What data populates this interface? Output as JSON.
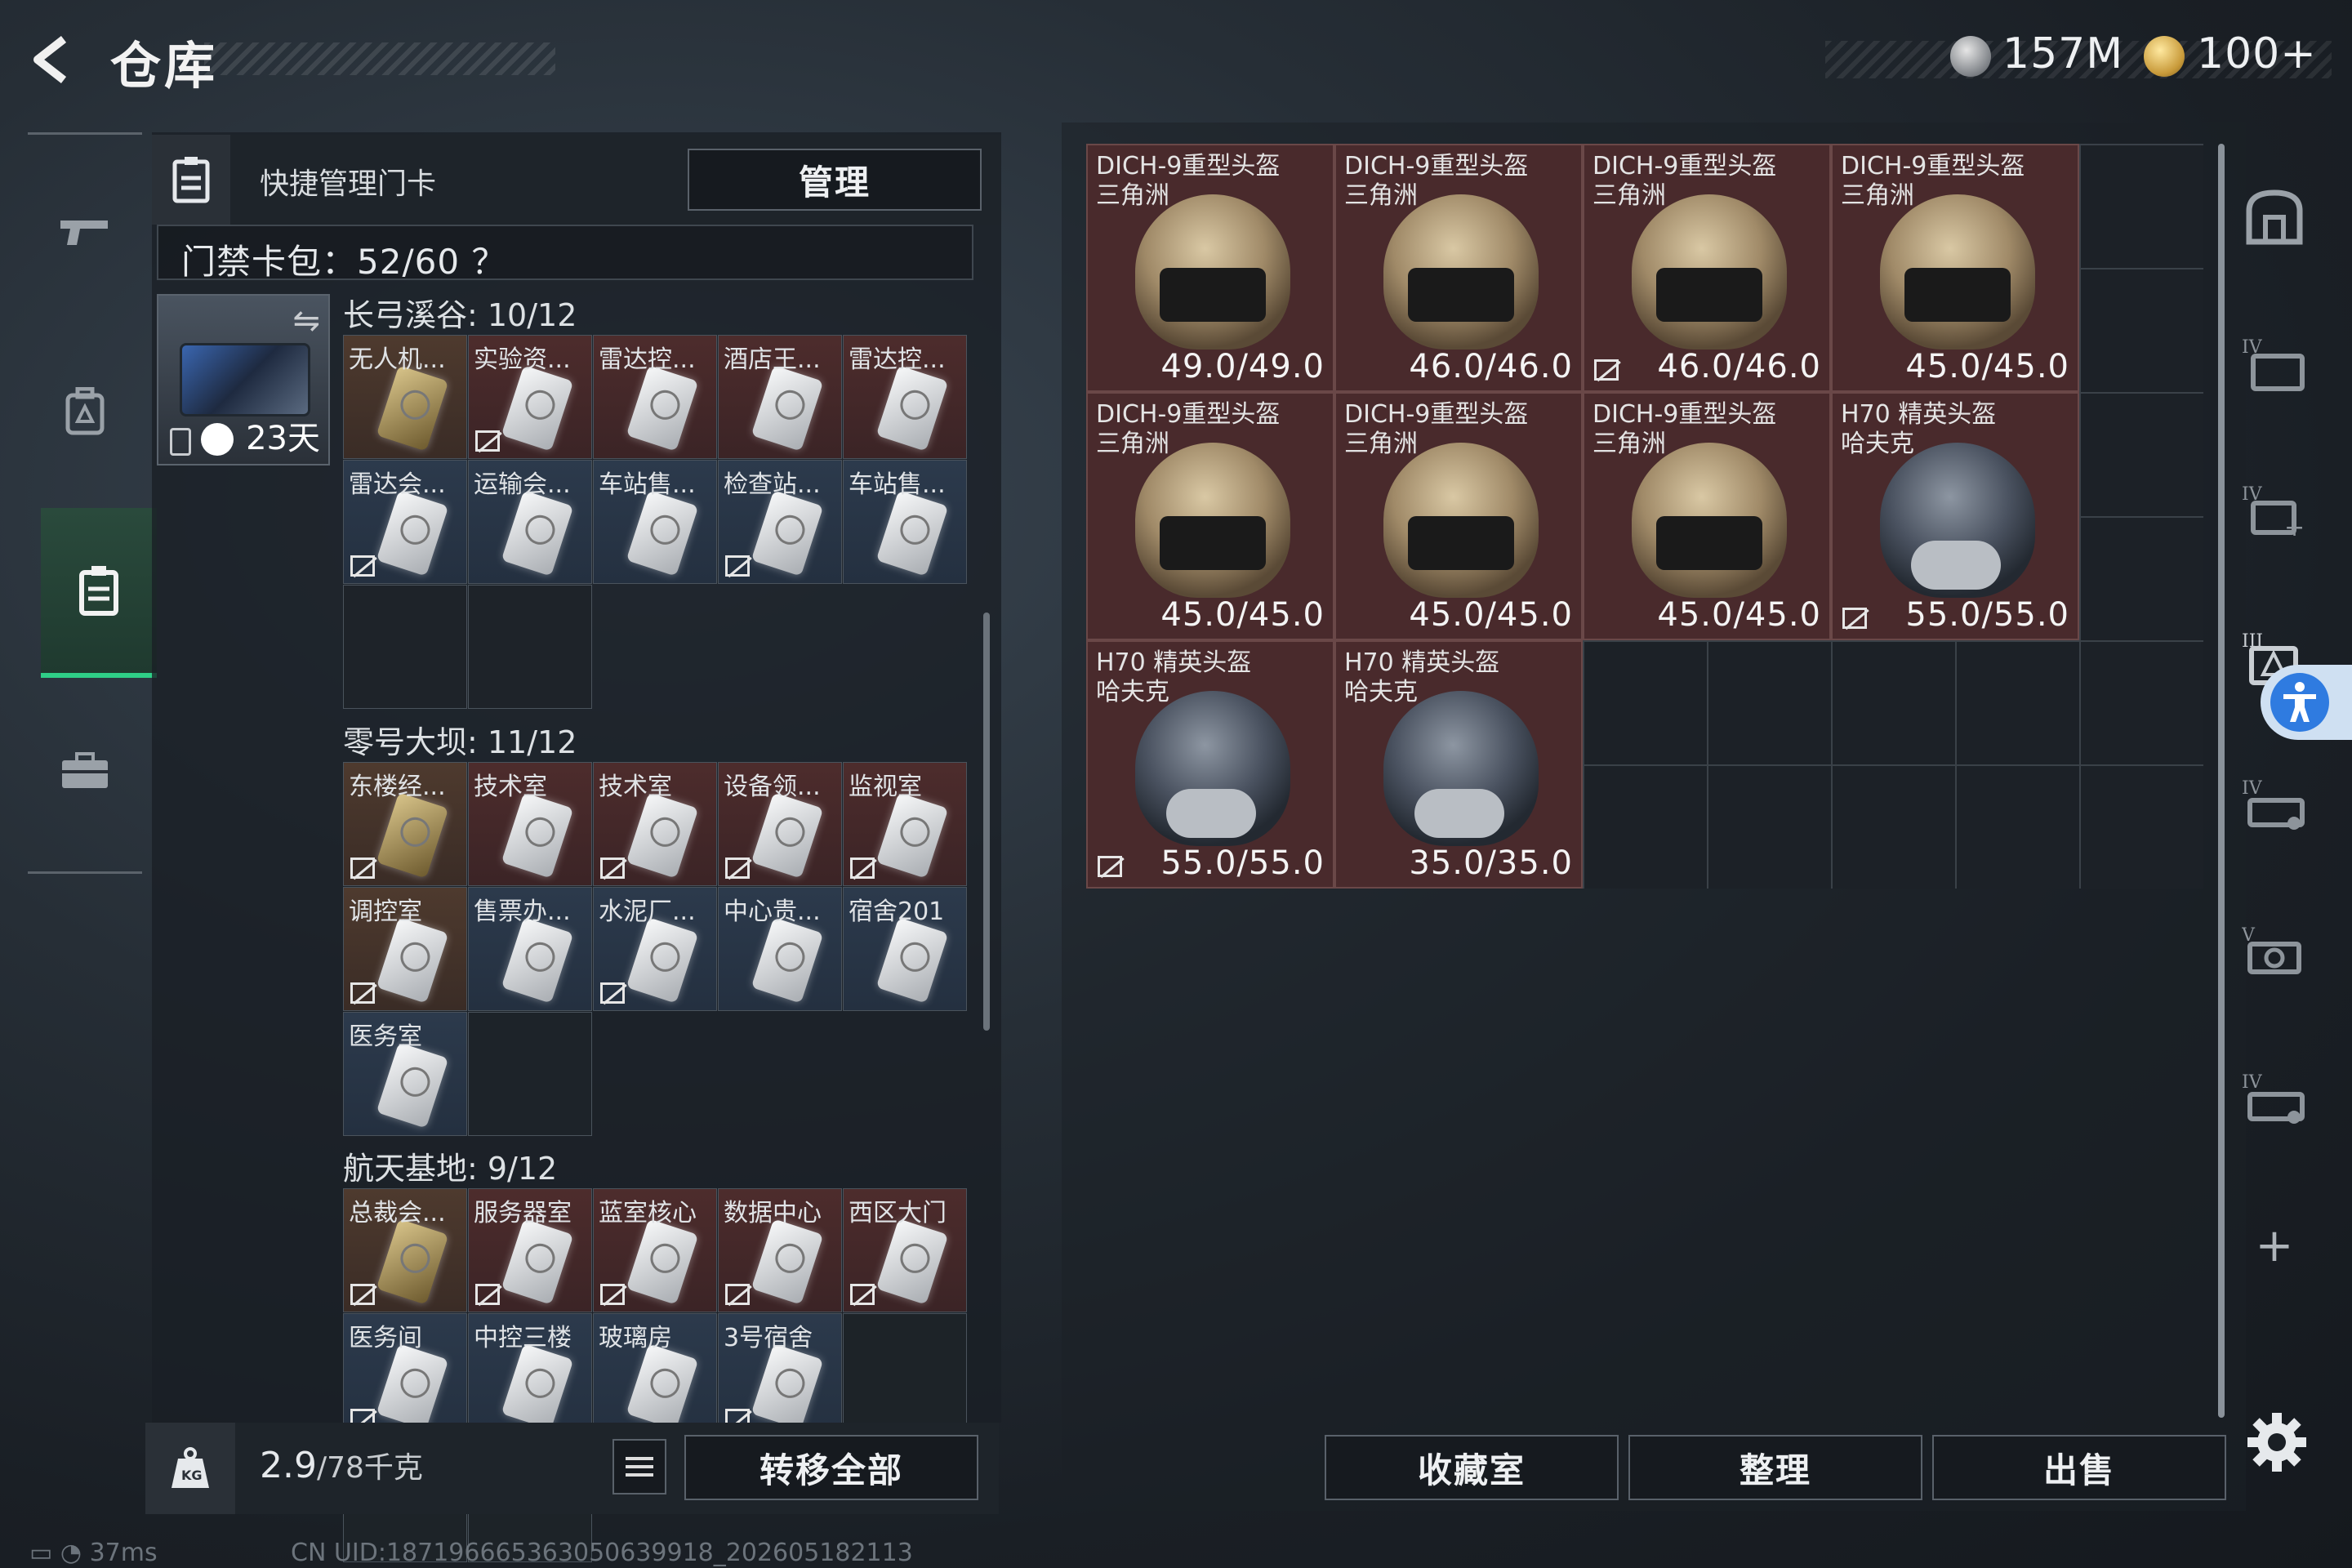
{
  "header": {
    "title": "仓库",
    "currency_silver": "157M",
    "currency_gold": "100+"
  },
  "quick_manage": {
    "label": "快捷管理门卡",
    "manage_button": "管理"
  },
  "card_pack": {
    "label": "门禁卡包：52/60 ？"
  },
  "card_box": {
    "days": "23天"
  },
  "sections": [
    {
      "title": "长弓溪谷: 10/12",
      "cards": [
        {
          "label": "无人机...",
          "style": "gold",
          "gold": true,
          "no_trade": false
        },
        {
          "label": "实验资...",
          "style": "red",
          "gold": false,
          "no_trade": true
        },
        {
          "label": "雷达控...",
          "style": "red",
          "gold": false,
          "no_trade": false
        },
        {
          "label": "酒店王...",
          "style": "red",
          "gold": false,
          "no_trade": false
        },
        {
          "label": "雷达控...",
          "style": "red",
          "gold": false,
          "no_trade": false
        },
        {
          "label": "雷达会...",
          "style": "blue",
          "gold": false,
          "no_trade": true
        },
        {
          "label": "运输会...",
          "style": "blue",
          "gold": false,
          "no_trade": false
        },
        {
          "label": "车站售...",
          "style": "blue",
          "gold": false,
          "no_trade": false
        },
        {
          "label": "检查站...",
          "style": "blue",
          "gold": false,
          "no_trade": true
        },
        {
          "label": "车站售...",
          "style": "blue",
          "gold": false,
          "no_trade": false
        }
      ]
    },
    {
      "title": "零号大坝: 11/12",
      "cards": [
        {
          "label": "东楼经...",
          "style": "gold",
          "gold": true,
          "no_trade": true
        },
        {
          "label": "技术室",
          "style": "red",
          "gold": false,
          "no_trade": false
        },
        {
          "label": "技术室",
          "style": "red",
          "gold": false,
          "no_trade": true
        },
        {
          "label": "设备领...",
          "style": "red",
          "gold": false,
          "no_trade": true
        },
        {
          "label": "监视室",
          "style": "red",
          "gold": false,
          "no_trade": true
        },
        {
          "label": "调控室",
          "style": "gold",
          "gold": false,
          "no_trade": true
        },
        {
          "label": "售票办...",
          "style": "blue",
          "gold": false,
          "no_trade": false
        },
        {
          "label": "水泥厂...",
          "style": "blue",
          "gold": false,
          "no_trade": true
        },
        {
          "label": "中心贵...",
          "style": "blue",
          "gold": false,
          "no_trade": false
        },
        {
          "label": "宿舍201",
          "style": "blue",
          "gold": false,
          "no_trade": false
        },
        {
          "label": "医务室",
          "style": "blue",
          "gold": false,
          "no_trade": false
        }
      ]
    },
    {
      "title": "航天基地: 9/12",
      "cards": [
        {
          "label": "总裁会...",
          "style": "gold",
          "gold": true,
          "no_trade": true
        },
        {
          "label": "服务器室",
          "style": "red",
          "gold": false,
          "no_trade": true
        },
        {
          "label": "蓝室核心",
          "style": "red",
          "gold": false,
          "no_trade": true
        },
        {
          "label": "数据中心",
          "style": "red",
          "gold": false,
          "no_trade": true
        },
        {
          "label": "西区大门",
          "style": "red",
          "gold": false,
          "no_trade": true
        },
        {
          "label": "医务间",
          "style": "blue",
          "gold": false,
          "no_trade": true
        },
        {
          "label": "中控三楼",
          "style": "blue",
          "gold": false,
          "no_trade": false
        },
        {
          "label": "玻璃房",
          "style": "blue",
          "gold": false,
          "no_trade": false
        },
        {
          "label": "3号宿舍",
          "style": "blue",
          "gold": false,
          "no_trade": true
        }
      ]
    }
  ],
  "bottom_bar": {
    "weight": "2.9",
    "weight_max": "/78千克",
    "transfer_all": "转移全部"
  },
  "status_bar": {
    "ping": "37ms",
    "uid": "CN UID:18719666536305063991​8_202605182113"
  },
  "inventory": [
    {
      "line1": "DICH-9重型头盔",
      "line2": "三角洲",
      "durability": "49.0/49.0",
      "variant": "tan",
      "no_trade": false
    },
    {
      "line1": "DICH-9重型头盔",
      "line2": "三角洲",
      "durability": "46.0/46.0",
      "variant": "tan",
      "no_trade": false
    },
    {
      "line1": "DICH-9重型头盔",
      "line2": "三角洲",
      "durability": "46.0/46.0",
      "variant": "tan",
      "no_trade": true
    },
    {
      "line1": "DICH-9重型头盔",
      "line2": "三角洲",
      "durability": "45.0/45.0",
      "variant": "tan",
      "no_trade": false
    },
    {
      "line1": "DICH-9重型头盔",
      "line2": "三角洲",
      "durability": "45.0/45.0",
      "variant": "tan",
      "no_trade": false
    },
    {
      "line1": "DICH-9重型头盔",
      "line2": "三角洲",
      "durability": "45.0/45.0",
      "variant": "tan",
      "no_trade": false
    },
    {
      "line1": "DICH-9重型头盔",
      "line2": "三角洲",
      "durability": "45.0/45.0",
      "variant": "tan",
      "no_trade": false
    },
    {
      "line1": "H70 精英头盔",
      "line2": "哈夫克",
      "durability": "55.0/55.0",
      "variant": "dark",
      "no_trade": true
    },
    {
      "line1": "H70 精英头盔",
      "line2": "哈夫克",
      "durability": "55.0/55.0",
      "variant": "dark",
      "no_trade": true
    },
    {
      "line1": "H70 精英头盔",
      "line2": "哈夫克",
      "durability": "35.0/35.0",
      "variant": "dark",
      "no_trade": false
    }
  ],
  "actions": {
    "collection": "收藏室",
    "organize": "整理",
    "sell": "出售"
  },
  "right_nav": {
    "add": "+"
  },
  "icons": [
    "back-arrow-icon",
    "silver-coin-icon",
    "gold-coin-icon",
    "weapon-icon",
    "backpack-icon",
    "keycard-icon",
    "briefcase-icon",
    "card-holder-icon",
    "swap-icon",
    "lock-icon",
    "clock-icon",
    "weight-icon",
    "list-icon",
    "vault-icon",
    "accessibility-icon",
    "settings-gear-icon",
    "no-trade-icon"
  ]
}
